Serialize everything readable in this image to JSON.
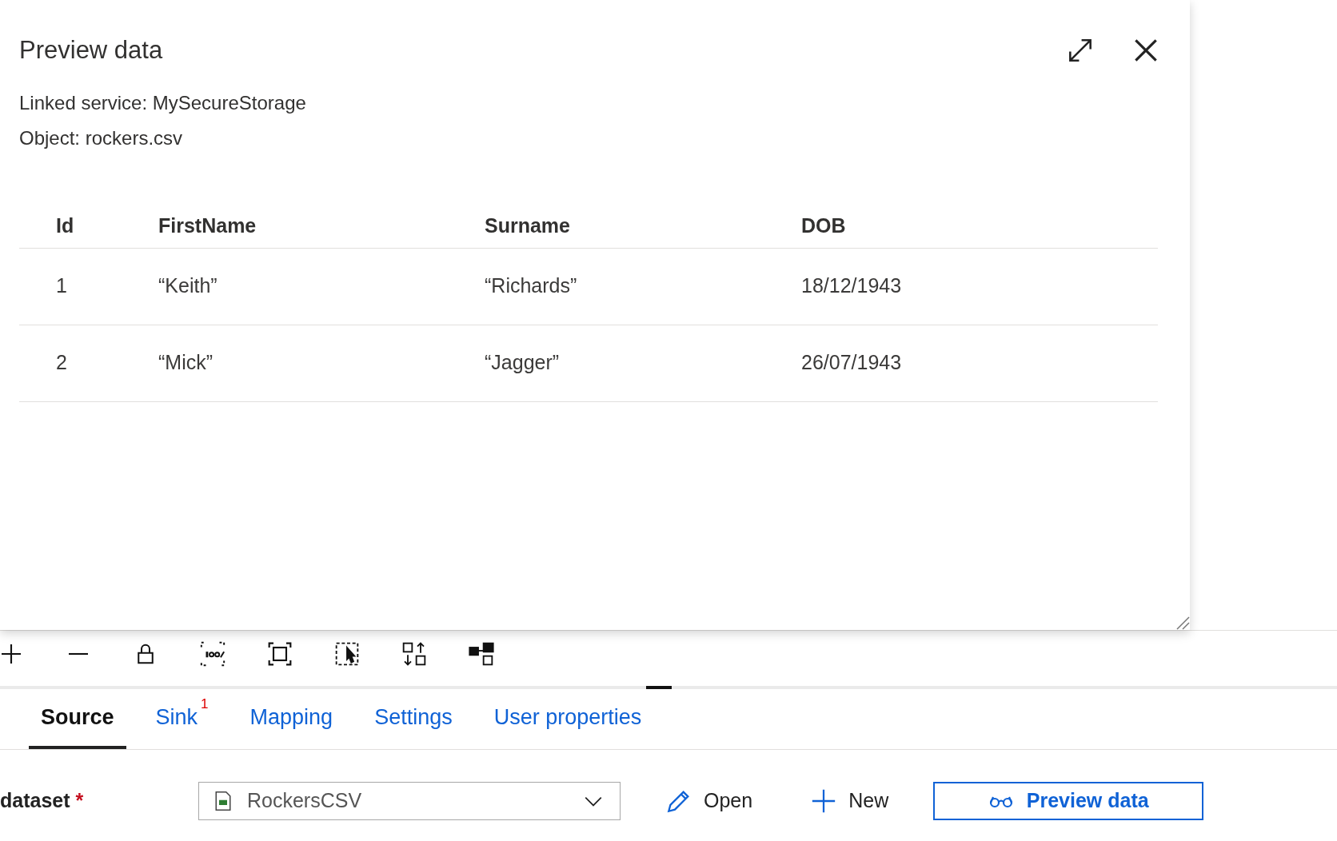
{
  "panel": {
    "title": "Preview data",
    "linked_service": "Linked service: MySecureStorage",
    "object": "Object: rockers.csv",
    "table": {
      "columns": [
        "Id",
        "FirstName",
        "Surname",
        "DOB"
      ],
      "rows": [
        [
          "1",
          "“Keith”",
          "“Richards”",
          "18/12/1943"
        ],
        [
          "2",
          "“Mick”",
          "“Jagger”",
          "26/07/1943"
        ]
      ]
    }
  },
  "tabs": [
    {
      "label": "Source",
      "selected": true
    },
    {
      "label": "Sink",
      "selected": false,
      "badge": "1"
    },
    {
      "label": "Mapping",
      "selected": false
    },
    {
      "label": "Settings",
      "selected": false
    },
    {
      "label": "User properties",
      "selected": false
    }
  ],
  "dataset": {
    "label": "dataset",
    "required_mark": "*",
    "value": "RockersCSV",
    "open": "Open",
    "new": "New",
    "preview": "Preview data"
  }
}
